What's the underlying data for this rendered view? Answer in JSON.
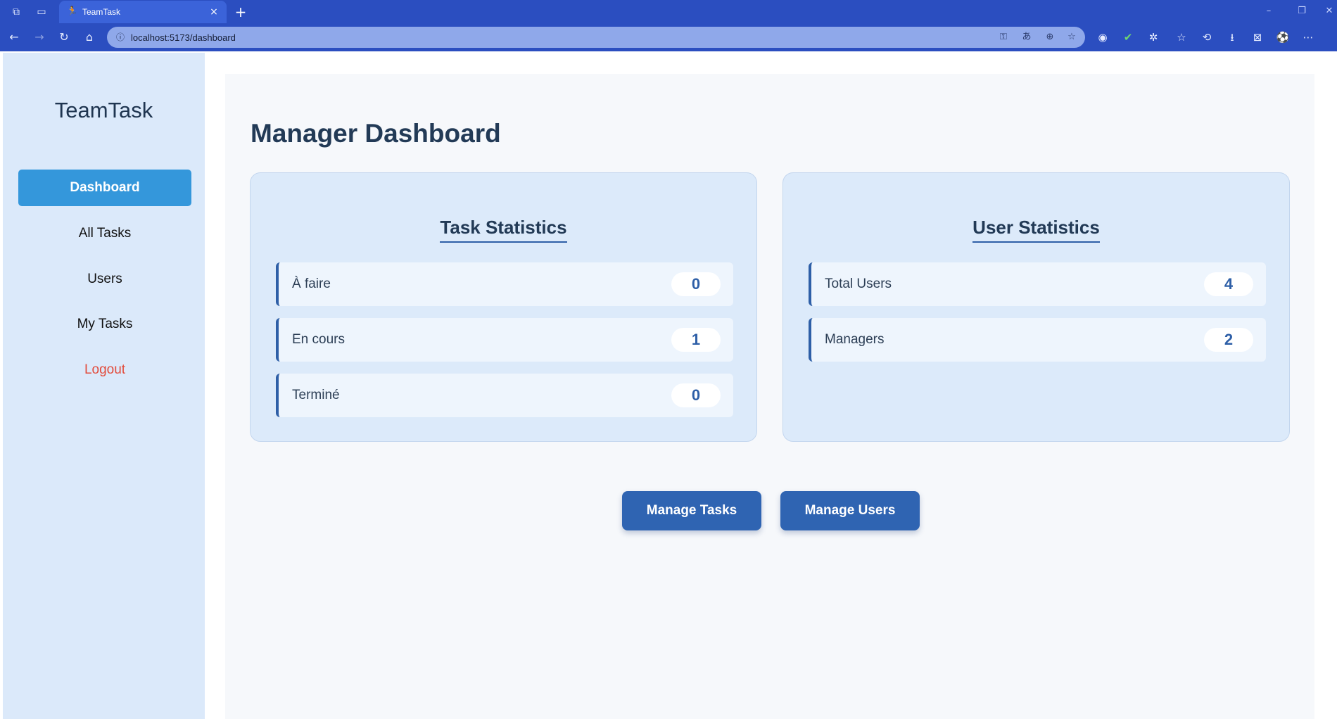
{
  "browser": {
    "tab_title": "TeamTask",
    "tab_icon": "running-person-icon",
    "url": "localhost:5173/dashboard"
  },
  "app": {
    "brand": "TeamTask",
    "sidebar": {
      "items": [
        {
          "label": "Dashboard",
          "active": true
        },
        {
          "label": "All Tasks",
          "active": false
        },
        {
          "label": "Users",
          "active": false
        },
        {
          "label": "My Tasks",
          "active": false
        },
        {
          "label": "Logout",
          "active": false
        }
      ]
    },
    "page_title": "Manager Dashboard",
    "task_stats": {
      "title": "Task Statistics",
      "rows": [
        {
          "label": "À faire",
          "value": "0"
        },
        {
          "label": "En cours",
          "value": "1"
        },
        {
          "label": "Terminé",
          "value": "0"
        }
      ]
    },
    "user_stats": {
      "title": "User Statistics",
      "rows": [
        {
          "label": "Total Users",
          "value": "4"
        },
        {
          "label": "Managers",
          "value": "2"
        }
      ]
    },
    "actions": {
      "manage_tasks": "Manage Tasks",
      "manage_users": "Manage Users"
    }
  },
  "colors": {
    "browser_chrome": "#2b4ec0",
    "sidebar_bg": "#dbe9fa",
    "active_nav": "#3497db",
    "logout": "#e24b3b",
    "primary_button": "#2f64b2",
    "card_bg": "#dceafa"
  }
}
